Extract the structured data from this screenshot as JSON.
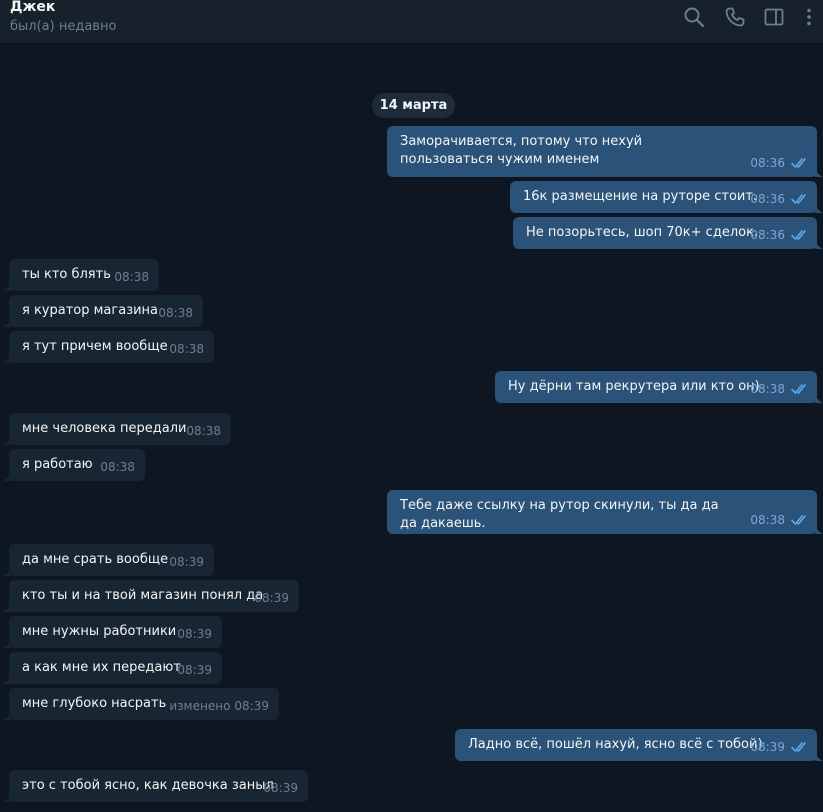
{
  "header": {
    "name": "Джек",
    "status": "был(а) недавно",
    "icons": [
      "search-icon",
      "phone-icon",
      "sidebar-toggle-icon",
      "more-vertical-icon"
    ]
  },
  "colors": {
    "background": "#0e1621",
    "header": "#17212b",
    "incoming_bubble": "#182533",
    "outgoing_bubble": "#2b5278",
    "time_in": "#6d7f8f",
    "time_out": "#7da8d3"
  },
  "chat": {
    "date_separator": "14 марта",
    "messages": [
      {
        "dir": "out",
        "text": "Заморачивается, потому что нехуй пользоваться чужим именем",
        "time": "08:36",
        "read": true
      },
      {
        "dir": "out",
        "text": "16к размещение на руторе стоит.",
        "time": "08:36",
        "read": true
      },
      {
        "dir": "out",
        "text": "Не позорьтесь, шоп 70к+ сделок.",
        "time": "08:36",
        "read": true
      },
      {
        "dir": "in",
        "text": "ты кто блять",
        "time": "08:38"
      },
      {
        "dir": "in",
        "text": "я куратор магазина",
        "time": "08:38"
      },
      {
        "dir": "in",
        "text": "я тут причем вообще",
        "time": "08:38"
      },
      {
        "dir": "out",
        "text": "Ну дёрни там рекрутера или кто он)",
        "time": "08:38",
        "read": true
      },
      {
        "dir": "in",
        "text": "мне человека передали",
        "time": "08:38"
      },
      {
        "dir": "in",
        "text": "я работаю",
        "time": "08:38"
      },
      {
        "dir": "out",
        "text": "Тебе даже ссылку на рутор скинули, ты да да да дакаешь.",
        "time": "08:38",
        "read": true
      },
      {
        "dir": "in",
        "text": "да мне срать вообще",
        "time": "08:39"
      },
      {
        "dir": "in",
        "text": "кто ты и на твой магазин понял да",
        "time": "08:39"
      },
      {
        "dir": "in",
        "text": "мне нужны работники",
        "time": "08:39"
      },
      {
        "dir": "in",
        "text": "а как мне их передают",
        "time": "08:39"
      },
      {
        "dir": "in",
        "text": "мне глубоко насрать",
        "time": "08:39",
        "edited": "изменено"
      },
      {
        "dir": "out",
        "text": "Ладно всё, пошёл нахуй, ясно всё с тобой)",
        "time": "08:39",
        "read": true
      },
      {
        "dir": "in",
        "text": "это с тобой ясно, как девочка заныл",
        "time": "08:39"
      }
    ]
  }
}
